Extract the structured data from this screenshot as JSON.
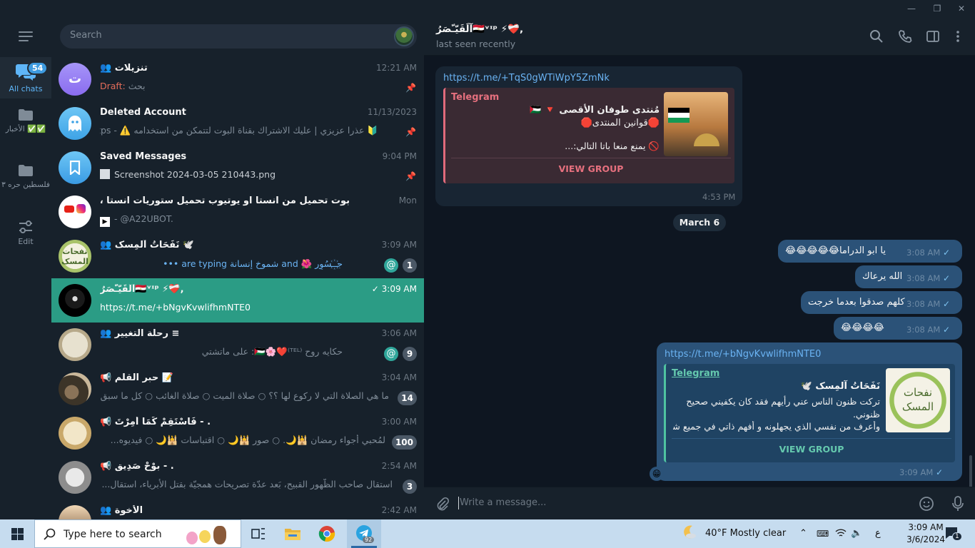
{
  "window": {
    "minimize": "—",
    "maximize": "❐",
    "close": "✕"
  },
  "folders": [
    {
      "label": "All chats",
      "badge": "54"
    },
    {
      "label": "الأخبار ✅✅"
    },
    {
      "label": "فلسطين حره ٣"
    },
    {
      "label": "Edit"
    }
  ],
  "search": {
    "placeholder": "Search"
  },
  "chats": [
    {
      "initial": "ت",
      "name": "تنزيلات",
      "time": "12:21 AM",
      "draft_label": "Draft:",
      "preview": "بحث"
    },
    {
      "name": "Deleted Account",
      "time": "11/13/2023",
      "preview": "🔰 عذرا عزيزي | عليك الاشتراك بقناة البوت لتتمكن من استخدامه ⚠️ - https..."
    },
    {
      "name": "Saved Messages",
      "time": "9:04 PM",
      "preview": "Screenshot 2024-03-05 210443.png"
    },
    {
      "name": "بوت تحميل من انستا او يوتيوب تحميل ستوريات انستا ، تيكتوك ،",
      "time": "Mon",
      "preview": "- @A22UBOT."
    },
    {
      "name": "نَفَحَاتُ آلمِسک 🕊️",
      "time": "3:09 AM",
      "preview": "جـ꙰ـسُوِر 🌺 and شموخ إنسانة are typing •••",
      "count": "1"
    },
    {
      "name": "آلَقَيّـّصَرُ🇪🇬ᵛᶦᵖ ⚡❤️‍🩹,",
      "time": "3:09 AM",
      "preview": "https://t.me/+bNgvKvwlifhmNTE0"
    },
    {
      "name": "رحلة التغيير ≡",
      "time": "3:06 AM",
      "preview": "حكايه روح ⁽ᵀᴱᴸ⁾❤️🌸🇵🇸: على ماتشتي",
      "count": "9"
    },
    {
      "name": "حبر القلم 📝",
      "time": "3:04 AM",
      "preview": "ما هي الصلاة التي لا ركوع لها ؟؟ ○ صلاة الميت ○ صلاة الغائب ○ كل ما سبق -",
      "count": "14"
    },
    {
      "name": "فَاسْتَقِمْ كَمَا أُمِرْتَ - .",
      "time": "3:00 AM",
      "preview": "لمُحبي أجواء رمضان 🕌🌙. ○ صور 🕌🌙 ○ اقتباسات 🕌🌙 ○ فيديوه...",
      "count": "100"
    },
    {
      "name": "بوْحْ صَدِيق - .",
      "time": "2:54 AM",
      "preview": "استقال صاحب الظّهور القبيح، بَعد عدّة تصريحات همجيّة بقتل الأبرياء، استقال...",
      "count": "3"
    },
    {
      "name": "الأخوة",
      "time": "2:42 AM",
      "preview": ""
    }
  ],
  "chat": {
    "title": "آلَقَيّـّصَرُ🇪🇬ᵛᶦᵖ ⚡❤️‍🩹,",
    "status": "last seen recently",
    "messages": {
      "in1": {
        "link": "https://t.me/+TqS0gWTiWpY5ZmNk",
        "site": "Telegram",
        "title": "مُنتدى طوفان الأقصى 🔻 🇵🇸",
        "line2": "🛑قوانين المنتدى🛑",
        "line3": "🚫 يمنع منعا باتا التالي:...",
        "button": "VIEW GROUP",
        "time": "4:53 PM"
      },
      "date": "March 6",
      "out1": {
        "text": "يا ابو الدراما😂😂😂😂😂",
        "time": "3:08 AM"
      },
      "out2": {
        "text": "الله يرعاك",
        "time": "3:08 AM"
      },
      "out3": {
        "text": "كلهم صدقوا بعدما خرجت",
        "time": "3:08 AM"
      },
      "out4": {
        "text": "😂😂😂😂",
        "time": "3:08 AM"
      },
      "out5": {
        "link": "https://t.me/+bNgvKvwlifhmNTE0",
        "site": "Telegram",
        "title": "نَفَحَاتُ آلمِسک 🕊️",
        "line2": "تركت ظنون الناس عني رأيهم فقد كان يكفيني صحيح ظنوني.",
        "line3": "وأعرف من نفسي الذي يجهلونه و أفهم ذاتي في جميع شؤ...",
        "button": "VIEW GROUP",
        "reaction": "😁",
        "time": "3:09 AM"
      }
    },
    "composer": {
      "placeholder": "Write a message..."
    }
  },
  "taskbar": {
    "search_text": "Type here to search",
    "telegram_badge": "92",
    "weather": "40°F  Mostly clear",
    "lang": "ع",
    "time": "3:09 AM",
    "date": "3/6/2024",
    "notif": "1"
  }
}
